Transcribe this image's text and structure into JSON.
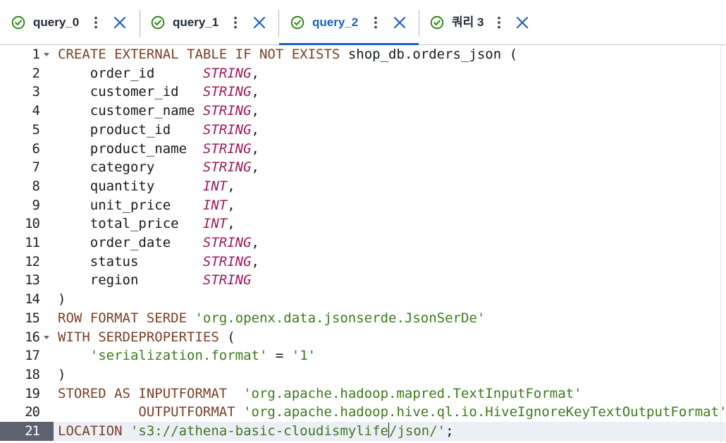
{
  "tabs": [
    {
      "label": "query_0",
      "status": "success",
      "active": false
    },
    {
      "label": "query_1",
      "status": "success",
      "active": false
    },
    {
      "label": "query_2",
      "status": "success",
      "active": true
    },
    {
      "label": "쿼리 3",
      "status": "success",
      "active": false
    }
  ],
  "colors": {
    "keyword": "#7b3f27",
    "type": "#a0175e",
    "string": "#3d7a1b",
    "active_tab": "#1f5fc4",
    "current_line_gutter": "#5e6170"
  },
  "editor": {
    "current_line": 21,
    "fold_lines": [
      1,
      16
    ],
    "lines": [
      {
        "n": "1",
        "tokens": [
          [
            "kw",
            "CREATE EXTERNAL TABLE IF NOT EXISTS "
          ],
          [
            "id",
            "shop_db.orders_json ("
          ]
        ]
      },
      {
        "n": "2",
        "tokens": [
          [
            "id",
            "    order_id      "
          ],
          [
            "ty",
            "STRING"
          ],
          [
            "id",
            ","
          ]
        ]
      },
      {
        "n": "3",
        "tokens": [
          [
            "id",
            "    customer_id   "
          ],
          [
            "ty",
            "STRING"
          ],
          [
            "id",
            ","
          ]
        ]
      },
      {
        "n": "4",
        "tokens": [
          [
            "id",
            "    customer_name "
          ],
          [
            "ty",
            "STRING"
          ],
          [
            "id",
            ","
          ]
        ]
      },
      {
        "n": "5",
        "tokens": [
          [
            "id",
            "    product_id    "
          ],
          [
            "ty",
            "STRING"
          ],
          [
            "id",
            ","
          ]
        ]
      },
      {
        "n": "6",
        "tokens": [
          [
            "id",
            "    product_name  "
          ],
          [
            "ty",
            "STRING"
          ],
          [
            "id",
            ","
          ]
        ]
      },
      {
        "n": "7",
        "tokens": [
          [
            "id",
            "    category      "
          ],
          [
            "ty",
            "STRING"
          ],
          [
            "id",
            ","
          ]
        ]
      },
      {
        "n": "8",
        "tokens": [
          [
            "id",
            "    quantity      "
          ],
          [
            "ty",
            "INT"
          ],
          [
            "id",
            ","
          ]
        ]
      },
      {
        "n": "9",
        "tokens": [
          [
            "id",
            "    unit_price    "
          ],
          [
            "ty",
            "INT"
          ],
          [
            "id",
            ","
          ]
        ]
      },
      {
        "n": "10",
        "tokens": [
          [
            "id",
            "    total_price   "
          ],
          [
            "ty",
            "INT"
          ],
          [
            "id",
            ","
          ]
        ]
      },
      {
        "n": "11",
        "tokens": [
          [
            "id",
            "    order_date    "
          ],
          [
            "ty",
            "STRING"
          ],
          [
            "id",
            ","
          ]
        ]
      },
      {
        "n": "12",
        "tokens": [
          [
            "id",
            "    status        "
          ],
          [
            "ty",
            "STRING"
          ],
          [
            "id",
            ","
          ]
        ]
      },
      {
        "n": "13",
        "tokens": [
          [
            "id",
            "    region        "
          ],
          [
            "ty",
            "STRING"
          ]
        ]
      },
      {
        "n": "14",
        "tokens": [
          [
            "id",
            ")"
          ]
        ]
      },
      {
        "n": "15",
        "tokens": [
          [
            "kw",
            "ROW FORMAT SERDE "
          ],
          [
            "str",
            "'org.openx.data.jsonserde.JsonSerDe'"
          ]
        ]
      },
      {
        "n": "16",
        "tokens": [
          [
            "kw",
            "WITH SERDEPROPERTIES "
          ],
          [
            "id",
            "("
          ]
        ]
      },
      {
        "n": "17",
        "tokens": [
          [
            "id",
            "    "
          ],
          [
            "str",
            "'serialization.format'"
          ],
          [
            "id",
            " = "
          ],
          [
            "str",
            "'1'"
          ]
        ]
      },
      {
        "n": "18",
        "tokens": [
          [
            "id",
            ")"
          ]
        ]
      },
      {
        "n": "19",
        "tokens": [
          [
            "kw",
            "STORED AS INPUTFORMAT  "
          ],
          [
            "str",
            "'org.apache.hadoop.mapred.TextInputFormat'"
          ]
        ]
      },
      {
        "n": "20",
        "tokens": [
          [
            "kw",
            "          OUTPUTFORMAT "
          ],
          [
            "str",
            "'org.apache.hadoop.hive.ql.io.HiveIgnoreKeyTextOutputFormat'"
          ]
        ]
      },
      {
        "n": "21",
        "tokens": [
          [
            "kw",
            "LOCATION "
          ],
          [
            "str",
            "'s3://athena-basic-cloudismylife"
          ],
          [
            "cursor",
            ""
          ],
          [
            "str",
            "/json/'"
          ],
          [
            "id",
            ";"
          ]
        ]
      }
    ]
  }
}
